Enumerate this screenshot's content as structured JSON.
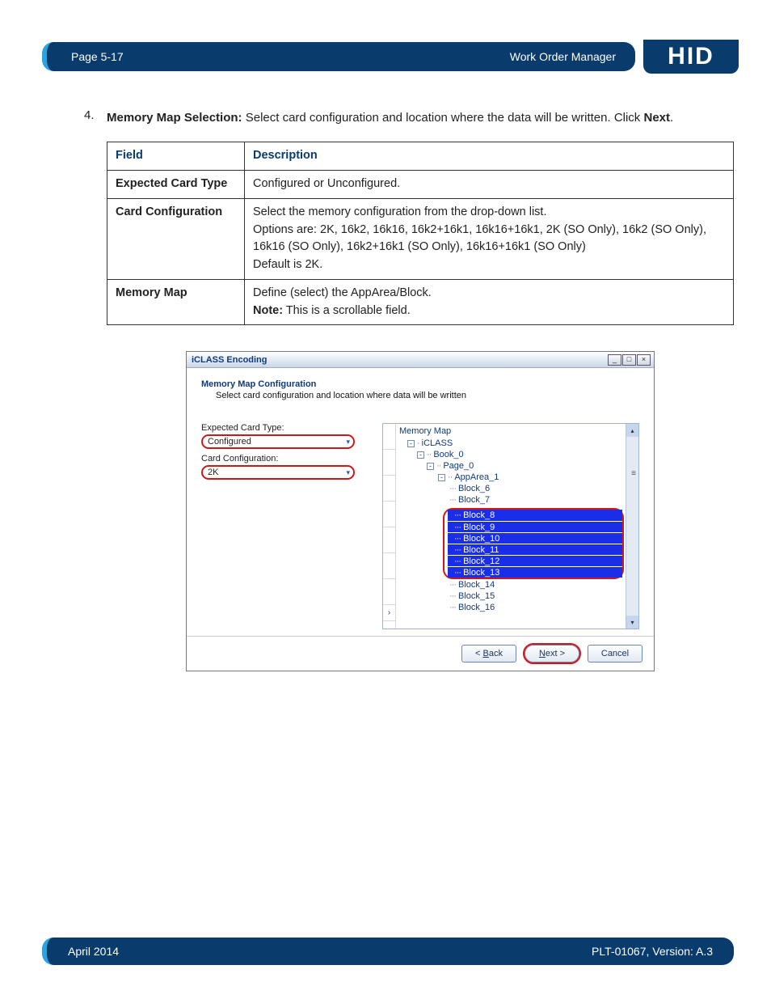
{
  "header": {
    "page": "Page 5-17",
    "section": "Work Order Manager",
    "logo": "HID"
  },
  "step": {
    "number": "4.",
    "title": "Memory Map Selection:",
    "body": "Select card configuration and location where the data will be written. Click",
    "next": "Next",
    "tail": "."
  },
  "table": {
    "headers": {
      "field": "Field",
      "desc": "Description"
    },
    "rows": [
      {
        "field": "Expected Card Type",
        "desc": "Configured or Unconfigured."
      },
      {
        "field": "Card Configuration",
        "desc_lines": [
          "Select the memory configuration from the drop-down list.",
          "Options are: 2K, 16k2, 16k16, 16k2+16k1, 16k16+16k1, 2K (SO Only), 16k2 (SO Only), 16k16 (SO Only), 16k2+16k1 (SO Only), 16k16+16k1 (SO Only)",
          "Default is 2K."
        ]
      },
      {
        "field": "Memory Map",
        "desc_lines": [
          "Define (select) the AppArea/Block.",
          "<b>Note:</b> This is a scrollable field."
        ]
      }
    ]
  },
  "dialog": {
    "title": "iCLASS Encoding",
    "section_title": "Memory Map  Configuration",
    "section_sub": "Select card configuration and location where data will be written",
    "labels": {
      "expected": "Expected Card Type:",
      "cardconf": "Card Configuration:"
    },
    "values": {
      "expected": "Configured",
      "cardconf": "2K"
    },
    "tree": {
      "header": "Memory Map",
      "root": "iCLASS",
      "book": "Book_0",
      "page": "Page_0",
      "apparea": "AppArea_1",
      "pre_blocks": [
        "Block_6",
        "Block_7"
      ],
      "selected_blocks": [
        "Block_8",
        "Block_9",
        "Block_10",
        "Block_11",
        "Block_12",
        "Block_13"
      ],
      "post_blocks": [
        "Block_14",
        "Block_15",
        "Block_16"
      ]
    },
    "buttons": {
      "back": "< Back",
      "next": "Next >",
      "cancel": "Cancel"
    }
  },
  "footer": {
    "date": "April 2014",
    "doc": "PLT-01067, Version: A.3"
  }
}
